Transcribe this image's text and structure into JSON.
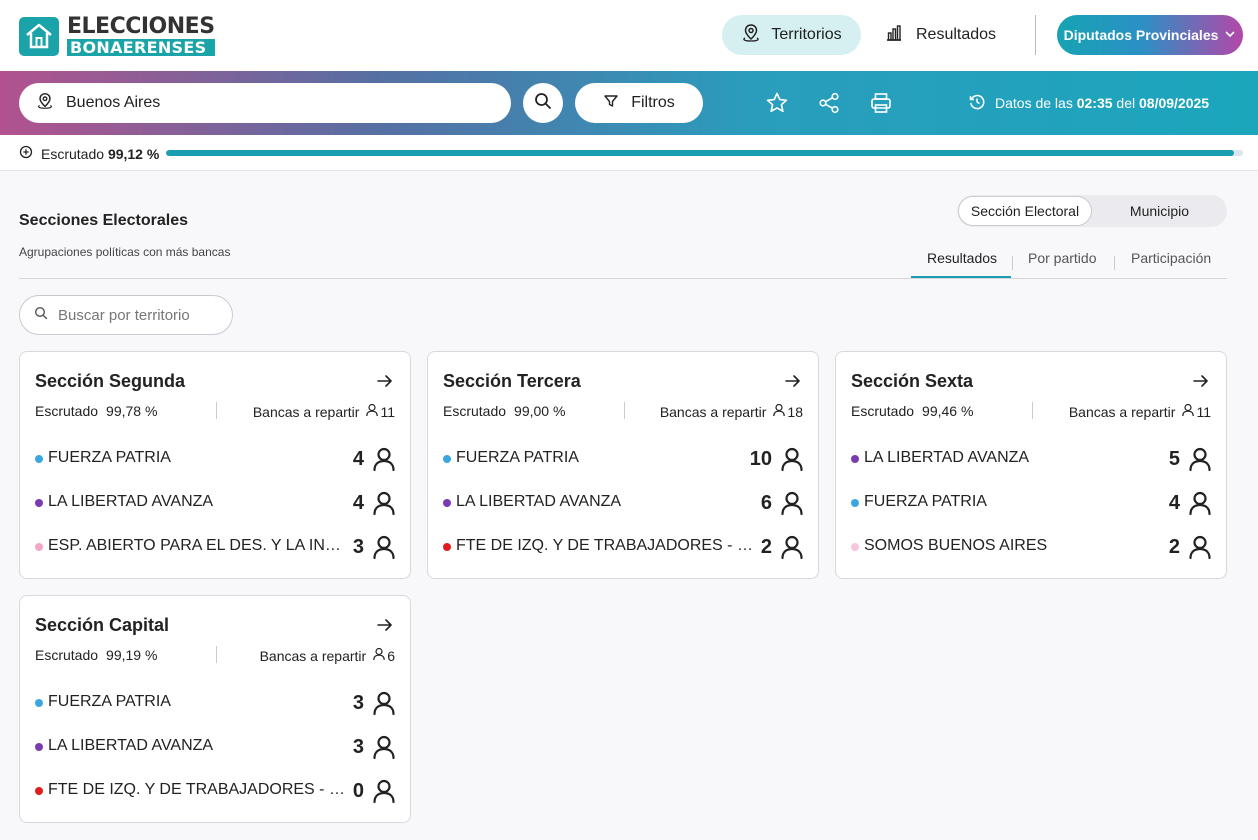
{
  "header": {
    "logo_line1": "ELECCIONES",
    "logo_line2": "BONAERENSES",
    "nav_territorios": "Territorios",
    "nav_resultados": "Resultados",
    "cargo": "Diputados Provinciales"
  },
  "toolbar": {
    "location": "Buenos Aires",
    "filtros": "Filtros",
    "datos_prefix": "Datos de las",
    "datos_time": "02:35",
    "datos_mid": "del",
    "datos_date": "08/09/2025"
  },
  "progress": {
    "label": "Escrutado",
    "value_text": "99,12 %",
    "fraction": 0.9912
  },
  "section": {
    "title": "Secciones Electorales",
    "subtitle": "Agrupaciones políticas con más bancas",
    "toggle": [
      "Sección Electoral",
      "Municipio"
    ],
    "tabs": [
      "Resultados",
      "Por partido",
      "Participación"
    ],
    "search_placeholder": "Buscar por territorio"
  },
  "colors": {
    "accent": "#1a9db1",
    "fuerza_patria": "#3aa8de",
    "libertad_avanza": "#7b3bb0",
    "esp_abierto": "#f2a6c8",
    "fte_izquierda": "#e01e1e",
    "somos_buenos_aires": "#f7c6dc"
  },
  "cards": [
    {
      "title": "Sección Segunda",
      "esc_label": "Escrutado",
      "esc_value": "99,78 %",
      "bancas_label": "Bancas a repartir",
      "bancas_value": "11",
      "parties": [
        {
          "name": "FUERZA PATRIA",
          "seats": "4",
          "color": "#3aa8de"
        },
        {
          "name": "LA LIBERTAD AVANZA",
          "seats": "4",
          "color": "#7b3bb0"
        },
        {
          "name": "ESP. ABIERTO PARA EL DES. Y LA INT. SOCIAL",
          "seats": "3",
          "color": "#f2a6c8"
        }
      ]
    },
    {
      "title": "Sección Tercera",
      "esc_label": "Escrutado",
      "esc_value": "99,00 %",
      "bancas_label": "Bancas a repartir",
      "bancas_value": "18",
      "parties": [
        {
          "name": "FUERZA PATRIA",
          "seats": "10",
          "color": "#3aa8de"
        },
        {
          "name": "LA LIBERTAD AVANZA",
          "seats": "6",
          "color": "#7b3bb0"
        },
        {
          "name": "FTE DE IZQ. Y DE TRABAJADORES - UNIDAD",
          "seats": "2",
          "color": "#e01e1e"
        }
      ]
    },
    {
      "title": "Sección Sexta",
      "esc_label": "Escrutado",
      "esc_value": "99,46 %",
      "bancas_label": "Bancas a repartir",
      "bancas_value": "11",
      "parties": [
        {
          "name": "LA LIBERTAD AVANZA",
          "seats": "5",
          "color": "#7b3bb0"
        },
        {
          "name": "FUERZA PATRIA",
          "seats": "4",
          "color": "#3aa8de"
        },
        {
          "name": "SOMOS BUENOS AIRES",
          "seats": "2",
          "color": "#f7c6dc"
        }
      ]
    },
    {
      "title": "Sección Capital",
      "esc_label": "Escrutado",
      "esc_value": "99,19 %",
      "bancas_label": "Bancas a repartir",
      "bancas_value": "6",
      "parties": [
        {
          "name": "FUERZA PATRIA",
          "seats": "3",
          "color": "#3aa8de"
        },
        {
          "name": "LA LIBERTAD AVANZA",
          "seats": "3",
          "color": "#7b3bb0"
        },
        {
          "name": "FTE DE IZQ. Y DE TRABAJADORES - UNIDAD",
          "seats": "0",
          "color": "#e01e1e"
        }
      ]
    }
  ]
}
